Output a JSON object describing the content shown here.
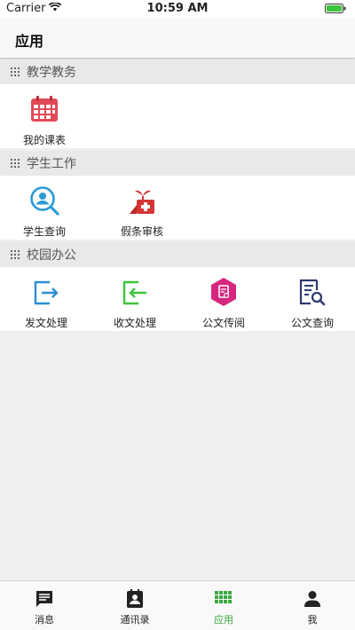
{
  "status_bar": {
    "carrier": "Carrier",
    "time": "10:59 AM"
  },
  "header": {
    "title": "应用"
  },
  "sections": [
    {
      "title": "教学教务",
      "items": [
        {
          "label": "我的课表",
          "icon": "calendar-icon"
        }
      ]
    },
    {
      "title": "学生工作",
      "items": [
        {
          "label": "学生查询",
          "icon": "person-search-icon"
        },
        {
          "label": "假条审核",
          "icon": "medical-leave-icon"
        }
      ]
    },
    {
      "title": "校园办公",
      "items": [
        {
          "label": "发文处理",
          "icon": "send-document-icon"
        },
        {
          "label": "收文处理",
          "icon": "receive-document-icon"
        },
        {
          "label": "公文传阅",
          "icon": "circulate-document-icon"
        },
        {
          "label": "公文查询",
          "icon": "document-search-icon"
        }
      ]
    }
  ],
  "tab_bar": {
    "tabs": [
      {
        "label": "消息",
        "icon": "message-icon"
      },
      {
        "label": "通讯录",
        "icon": "contacts-icon"
      },
      {
        "label": "应用",
        "icon": "apps-grid-icon"
      },
      {
        "label": "我",
        "icon": "person-icon"
      }
    ],
    "active": "应用"
  },
  "colors": {
    "accent_green": "#3aa840",
    "calendar_red": "#e04a57",
    "search_blue": "#2b9ad6",
    "leave_red": "#d43535",
    "send_blue": "#2b8fd6",
    "receive_green": "#3cc43c",
    "circulate_magenta": "#d6277f",
    "doc_search_navy": "#2d3a6e"
  }
}
